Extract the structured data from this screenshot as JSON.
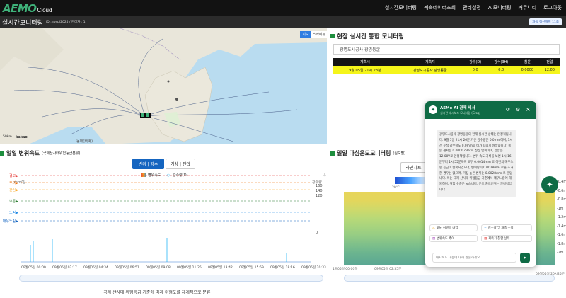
{
  "nav": {
    "logo": "AEMO",
    "logo_sub": "Cloud",
    "items": [
      "실시간모니터링",
      "계측데이터조회",
      "관리설정",
      "AI모니터링",
      "커뮤니티",
      "로그아웃"
    ]
  },
  "titlebar": {
    "title": "실시간모니터링",
    "sub": "ID : @spi2025 / 관리자 : 1",
    "badge": "자동 갱신까지 11초"
  },
  "map": {
    "tabs": [
      "지도",
      "스카이뷰"
    ],
    "scale": "50km",
    "brand": "kakao",
    "sea_label": "동해(東海)"
  },
  "realtime": {
    "title": "현장 실시간 통합 모니터링",
    "site": "광명도시공사 광명동굴",
    "columns": [
      "계측시",
      "계측지",
      "강수(D)",
      "강수(3H)",
      "침윤",
      "전압"
    ],
    "row": [
      "9월 05일 21시 28분",
      "광명도시공사 광명동굴",
      "0.0",
      "0.0",
      "0.0000",
      "12.00"
    ]
  },
  "disp": {
    "title": "일일 변위속도",
    "subtitle": "(국제산사태위험등급분류)",
    "btn_active": "변위 | 강수",
    "btn_other": "기상 | 전압",
    "legend": [
      "변위속도",
      "강수량(D)"
    ],
    "y_left_label": "mm/일",
    "y_right_label": "강수량",
    "levels": [
      "경고",
      "주의",
      "관심",
      "보통",
      "느림",
      "매우느림"
    ],
    "right_ticks": [
      "160",
      "140",
      "120",
      "",
      "",
      "",
      "",
      "0"
    ],
    "x_ticks": [
      "09월05일 00:00",
      "09월05일 02:17",
      "09월05일 04:34",
      "09월05일 06:51",
      "09월05일 09:08",
      "09월05일 11:25",
      "09월05일 13:42",
      "09월05일 15:59",
      "09월05일 18:16",
      "09월05일 20:33"
    ],
    "footer": "국제 산사태 위험등급 기준에 따라 위험도를 체계적으로 분류",
    "colors": {
      "경고": "#e53935",
      "주의": "#ef6c00",
      "관심": "#f9a825",
      "보통": "#2e7d32",
      "느림": "#1e88e5",
      "매우느림": "#1565c0"
    }
  },
  "temp": {
    "title": "일일 다심온도모니터링",
    "subtitle": "(심도별)",
    "btn": "라인차트",
    "scale_label": "20℃",
    "depths": [
      "-0.4m",
      "-0.6m",
      "-0.8m",
      "-1m",
      "-1.2m",
      "-1.4m",
      "-1.6m",
      "-1.8m",
      "-2m"
    ],
    "x_ticks": [
      "1월05일 00:00분",
      "09월05일 02:55분",
      "09월05일 20시25분"
    ]
  },
  "chat": {
    "title": "AEMo AI 관제 비서",
    "subtitle": "실시간 대시보드 모니터링 (Groq)",
    "message": "광명도시공사 광명동굴의 현재 실시간 상태는 안정적입니다. 9월 5일 21시 26분 기준 강수량은 0.0mm이며, 3시간 누적 강수량도 0.0mm로 비가 내리지 않았습니다. 충분 센서는 0.0000 cBar로 정상 범위이며, 전압은 12.00V로 안정적입니다. 변위 속도 기록을 보면 1시 16분부터 1시 55분까지 모두 0.0014mm 로 이전의 매우느림 등급이 반복되었으나, 변위량이 0.0028mm 로을 초과한 경우는 없으며, 가장 높은 변위는 0.0028mm 로 분입니다. 이는 국제 산사태 위험등급 기준에서 매우느림에 해당하며, 위험 수준은 낮습니다. 온도 차트변위는 안정적입니다.",
    "quick": [
      "오늘 이벤트 내역",
      "강수량 및 개측 수치",
      "변위속도 추이",
      "계측기 통합 상태"
    ],
    "placeholder": "대시보드 내용에 대해 질문하세요..."
  }
}
